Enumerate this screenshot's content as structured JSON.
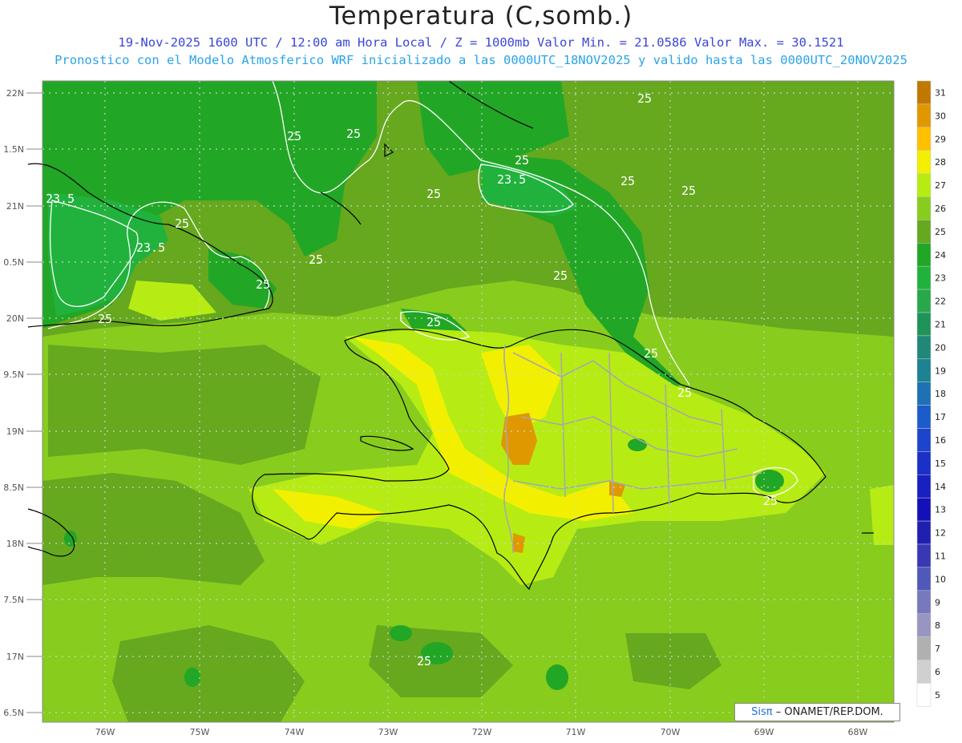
{
  "header": {
    "title": "Temperatura (C,somb.)",
    "subtitle_1": "19-Nov-2025 1600 UTC / 12:00 am Hora Local / Z = 1000mb  Valor Min. = 21.0586  Valor Max. = 30.1521",
    "subtitle_2": "Pronostico con el Modelo Atmosferico WRF inicializado a las 0000UTC_18NOV2025 y valido hasta las  0000UTC_20NOV2025"
  },
  "axes": {
    "lat_labels": [
      "22N",
      "1.5N",
      "21N",
      "0.5N",
      "20N",
      "9.5N",
      "19N",
      "8.5N",
      "18N",
      "7.5N",
      "17N",
      "6.5N"
    ],
    "lon_labels": [
      "76W",
      "75W",
      "74W",
      "73W",
      "72W",
      "71W",
      "70W",
      "69W",
      "68W"
    ]
  },
  "contour_labels": [
    "25",
    "25",
    "25",
    "23.5",
    "23.5",
    "25",
    "25",
    "25",
    "25",
    "25",
    "25",
    "25",
    "23.5",
    "25",
    "25",
    "25",
    "25",
    "25",
    "25",
    "25"
  ],
  "colorbar": {
    "labels": [
      "31",
      "30",
      "29",
      "28",
      "27",
      "26",
      "25",
      "24",
      "23",
      "22",
      "21",
      "20",
      "19",
      "18",
      "17",
      "16",
      "15",
      "14",
      "13",
      "12",
      "11",
      "10",
      "9",
      "8",
      "7",
      "6",
      "5"
    ],
    "colors": [
      "#c07800",
      "#e09800",
      "#ffc000",
      "#f2f000",
      "#b6ec14",
      "#88cc1e",
      "#66a81e",
      "#22a626",
      "#20b23c",
      "#28a84a",
      "#1e9458",
      "#208878",
      "#1c8294",
      "#1c72b4",
      "#1c5cca",
      "#1c44cc",
      "#1a30c6",
      "#1820c0",
      "#1410b8",
      "#2020b0",
      "#3838b4",
      "#5058b8",
      "#7878bc",
      "#9896c0",
      "#b0b0b0",
      "#d0d0d0",
      "#ffffff"
    ]
  },
  "credit": {
    "brand": "Sisπ",
    "text": "– ONAMET/REP.DOM."
  }
}
